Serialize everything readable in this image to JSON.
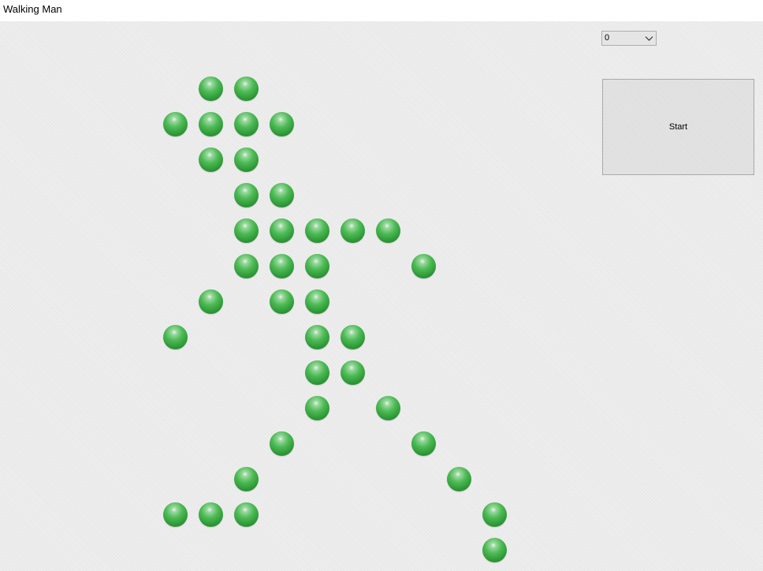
{
  "window": {
    "title": "Walking Man"
  },
  "controls": {
    "combo": {
      "selected": "0",
      "arrow_icon": "chevron-down-icon"
    },
    "start_label": "Start"
  },
  "colors": {
    "ball": "#3aa843",
    "background": "#eeeeee"
  },
  "figure": {
    "rows": [
      [
        1,
        2
      ],
      [
        0,
        1,
        2,
        3
      ],
      [
        1,
        2
      ],
      [
        2,
        3
      ],
      [
        2,
        3,
        4,
        5,
        6
      ],
      [
        2,
        3,
        4,
        7
      ],
      [
        1,
        3,
        4
      ],
      [
        0,
        4,
        5
      ],
      [
        4,
        5
      ],
      [
        4,
        6
      ],
      [
        3,
        7
      ],
      [
        2,
        8
      ],
      [
        0,
        1,
        2,
        9
      ],
      [
        9
      ]
    ]
  }
}
